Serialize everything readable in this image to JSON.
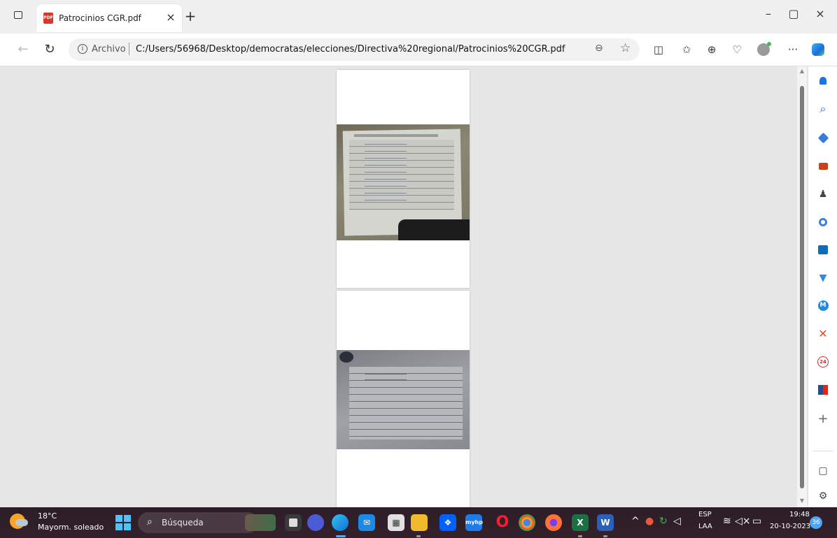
{
  "browser": {
    "tab": {
      "title": "Patrocinios CGR.pdf",
      "favicon": "pdf-icon",
      "close_glyph": "×"
    },
    "new_tab_glyph": "+",
    "window_controls": {
      "minimize": "–",
      "maximize": "▢",
      "close": "×"
    },
    "address_bar": {
      "scheme_label": "Archivo",
      "url": "C:/Users/56968/Desktop/democratas/elecciones/Directiva%20regional/Patrocinios%20CGR.pdf"
    },
    "toolbar_icons": [
      "split-screen-icon",
      "favorites-icon",
      "collections-icon",
      "browser-essentials-icon",
      "profile-icon",
      "more-icon",
      "copilot-icon"
    ]
  },
  "sidebar": {
    "items": [
      "notifications-icon",
      "search-icon",
      "shopping-icon",
      "tools-icon",
      "games-icon",
      "microsoft-365-icon",
      "outlook-icon",
      "drop-icon",
      "mercado-icon",
      "x-icon",
      "24-horas-icon",
      "flag-icon",
      "add-icon"
    ],
    "bottom": [
      "sidebar-toggle-icon",
      "settings-icon"
    ]
  },
  "taskbar": {
    "weather": {
      "temp": "18°C",
      "condition": "Mayorm. soleado"
    },
    "search_placeholder": "Búsqueda",
    "tray": {
      "language": "ESP",
      "layout": "LAA",
      "time": "19:48",
      "date": "20-10-2023",
      "notification_count": "36"
    }
  }
}
